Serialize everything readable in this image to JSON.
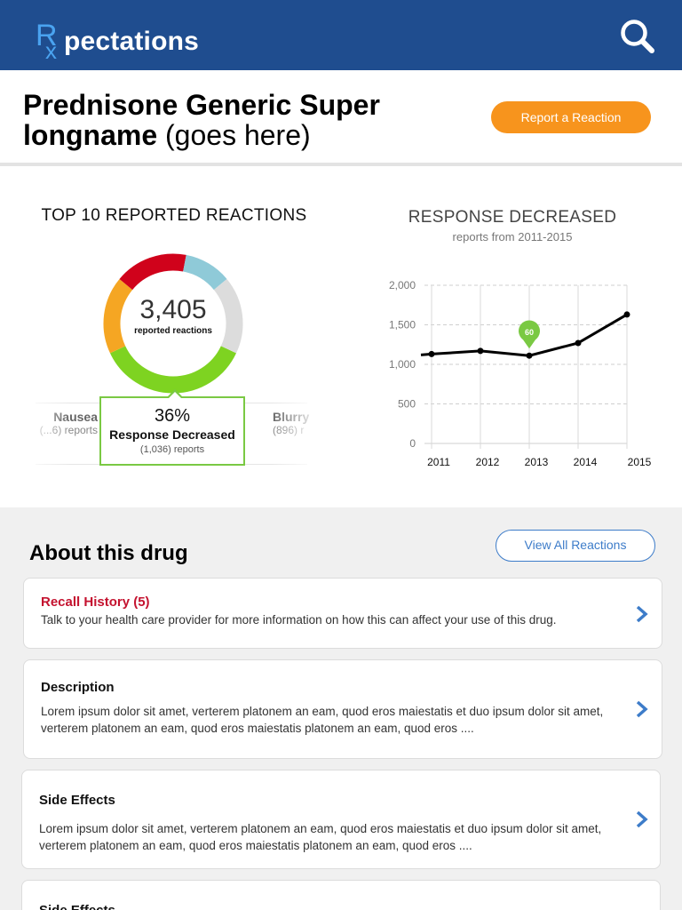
{
  "header": {
    "logo_r": "R",
    "logo_x": "x",
    "logo_text": "pectations",
    "colors": {
      "bar": "#1f4d8f",
      "logo_rx": "#4aa3f0"
    }
  },
  "drug": {
    "title_bold": "Prednisone Generic Super longname",
    "title_light": "(goes here)",
    "report_button": "Report a Reaction"
  },
  "top_reactions": {
    "title": "TOP 10 REPORTED REACTIONS",
    "total": "3,405",
    "total_label": "reported reactions",
    "left_item": {
      "name": "Nausea",
      "sub": "(...6) reports"
    },
    "right_item": {
      "name": "Blurry",
      "sub": "(896) r"
    },
    "selected": {
      "percent": "36%",
      "name": "Response Decreased",
      "sub": "(1,036) reports"
    },
    "donut_segments": [
      {
        "color": "#7ed321",
        "pct": 36
      },
      {
        "color": "#f5a623",
        "pct": 18
      },
      {
        "color": "#d0021b",
        "pct": 17
      },
      {
        "color": "#8fcad8",
        "pct": 11
      },
      {
        "color": "#dcdcdc",
        "pct": 18
      }
    ]
  },
  "response_chart": {
    "title": "RESPONSE DECREASED",
    "subtitle": "reports from 2011-2015"
  },
  "chart_data": {
    "type": "line",
    "title": "RESPONSE DECREASED",
    "subtitle": "reports from 2011-2015",
    "x": [
      2011,
      2012,
      2013,
      2014,
      2015
    ],
    "xticks": [
      "2011",
      "2012",
      "2013",
      "2014",
      "2015"
    ],
    "yticks": [
      "0",
      "500",
      "1,000",
      "1,500",
      "2,000"
    ],
    "series": [
      {
        "values": [
          1130,
          1170,
          1110,
          1270,
          1630
        ]
      }
    ],
    "ylim": [
      0,
      2000
    ],
    "grid": true,
    "marker_label": "60",
    "marker_index": 2,
    "colors": {
      "line": "#000000",
      "marker": "#7ac943"
    }
  },
  "about": {
    "title": "About this drug",
    "view_all": "View All Reactions",
    "cards": [
      {
        "title": "Recall History (5)",
        "body": "Talk to your health care provider for more information on how this can affect your use of this drug."
      },
      {
        "title": "Description",
        "body": "Lorem ipsum dolor sit amet, verterem platonem an eam, quod eros maiestatis et duo ipsum dolor sit amet, verterem platonem an eam, quod eros maiestatis platonem an eam, quod eros ...."
      },
      {
        "title": "Side Effects",
        "body": "Lorem ipsum dolor sit amet, verterem platonem an eam, quod eros maiestatis et duo ipsum dolor sit amet, verterem platonem an eam, quod eros maiestatis platonem an eam, quod eros ...."
      },
      {
        "title": "Side Effects",
        "body": ""
      }
    ]
  }
}
